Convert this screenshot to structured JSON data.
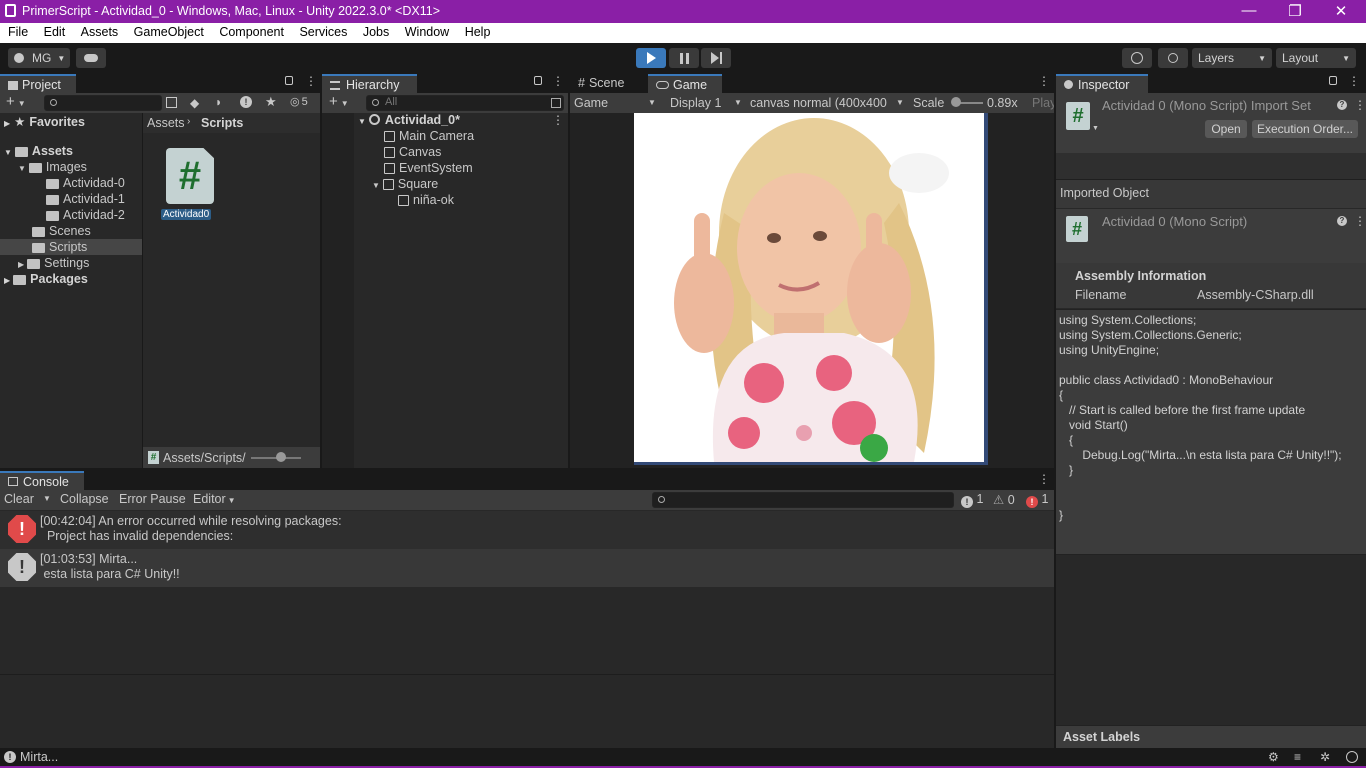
{
  "window": {
    "title": "PrimerScript - Actividad_0 - Windows, Mac, Linux - Unity 2022.3.0* <DX11>",
    "controls": [
      "—",
      "❐",
      "✕"
    ]
  },
  "menu": [
    "File",
    "Edit",
    "Assets",
    "GameObject",
    "Component",
    "Services",
    "Jobs",
    "Window",
    "Help"
  ],
  "toolbar": {
    "account": "MG",
    "layers": "Layers",
    "layout": "Layout"
  },
  "project": {
    "tab": "Project",
    "count": "5",
    "favorites": "Favorites",
    "tree": [
      {
        "label": "Assets",
        "bold": true
      },
      {
        "label": "Images"
      },
      {
        "label": "Actividad-0"
      },
      {
        "label": "Actividad-1"
      },
      {
        "label": "Actividad-2"
      },
      {
        "label": "Scenes"
      },
      {
        "label": "Scripts"
      },
      {
        "label": "Settings"
      },
      {
        "label": "Packages",
        "bold": true
      }
    ],
    "breadcrumb_root": "Assets",
    "breadcrumb_current": "Scripts",
    "asset_name": "Actividad0",
    "footer_path": "Assets/Scripts/"
  },
  "hierarchy": {
    "tab": "Hierarchy",
    "search_placeholder": "All",
    "scene": "Actividad_0*",
    "items": [
      "Main Camera",
      "Canvas",
      "EventSystem",
      "Square",
      "niña-ok"
    ]
  },
  "game": {
    "tab_scene": "Scene",
    "tab_game": "Game",
    "view": "Game",
    "display": "Display 1",
    "resolution": "canvas normal (400x400",
    "scale_label": "Scale",
    "scale_value": "0.89x",
    "play_label": "Play",
    "image_alt": "Girl giving thumbs up"
  },
  "inspector": {
    "tab": "Inspector",
    "header_title": "Actividad 0 (Mono Script) Import Set",
    "open": "Open",
    "execution_order": "Execution Order...",
    "imported_object": "Imported Object",
    "object_title": "Actividad 0 (Mono Script)",
    "assembly_info": "Assembly Information",
    "filename_label": "Filename",
    "filename_value": "Assembly-CSharp.dll",
    "code": [
      "using System.Collections;",
      "using System.Collections.Generic;",
      "using UnityEngine;",
      "",
      "public class Actividad0 : MonoBehaviour",
      "{",
      "   // Start is called before the first frame update",
      "   void Start()",
      "   {",
      "       Debug.Log(\"Mirta...\\n esta lista para C# Unity!!\");",
      "   }",
      "",
      "",
      "}"
    ],
    "asset_labels": "Asset Labels"
  },
  "console": {
    "tab": "Console",
    "clear": "Clear",
    "collapse": "Collapse",
    "error_pause": "Error Pause",
    "editor": "Editor",
    "count_log": "1",
    "count_warn": "0",
    "count_err": "1",
    "entries": [
      {
        "line1": "[00:42:04] An error occurred while resolving packages:",
        "line2": "  Project has invalid dependencies:"
      },
      {
        "line1": "[01:03:53] Mirta...",
        "line2": " esta lista para C# Unity!!"
      }
    ]
  },
  "status": {
    "message": "Mirta..."
  },
  "colors": {
    "titlebar": "#8a1fa6",
    "accent": "#3a79bb",
    "error": "#e04a4a"
  }
}
